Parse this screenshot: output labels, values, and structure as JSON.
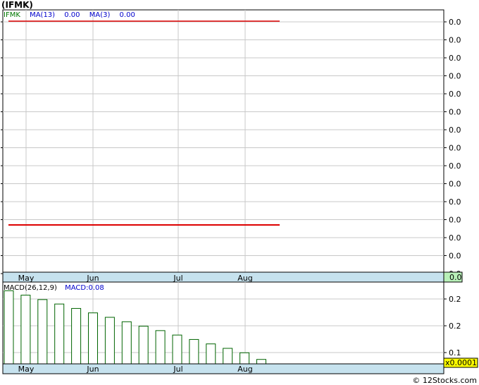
{
  "title": "(IFMK)",
  "credit": "© 12Stocks.com",
  "colors": {
    "grid": "#c8c8c8",
    "frame": "#000000",
    "ma_line": "#dd0000",
    "bar_stroke": "#006400",
    "axis_band": "#c6e2ee",
    "last_price_box": "#b8f0b8",
    "macd_box": "#ffff00",
    "ticker_color": "#007700",
    "ma_text_color": "#0000cc"
  },
  "price_panel": {
    "legend": {
      "ticker": "IFMK",
      "ma13_label": "MA(13)",
      "ma13_value": "0.00",
      "ma3_label": "MA(3)",
      "ma3_value": "0.00"
    },
    "y_tick_labels": [
      "0.0",
      "0.0",
      "0.0",
      "0.0",
      "0.0",
      "0.0",
      "0.0",
      "0.0",
      "0.0",
      "0.0",
      "0.0",
      "0.0",
      "0.0",
      "0.0",
      "0.0"
    ],
    "last_price_label": "0.0",
    "x_labels": [
      "May",
      "Jun",
      "Jul",
      "Aug"
    ]
  },
  "macd_panel": {
    "legend": {
      "label": "MACD(26,12,9)",
      "value_label": "MACD:0.08"
    },
    "y_tick_labels": [
      "0.2",
      "0.2",
      "0.1"
    ],
    "multiplier_label": "x0.0001",
    "x_labels": [
      "May",
      "Jun",
      "Jul",
      "Aug"
    ]
  },
  "chart_data": [
    {
      "type": "line",
      "title": "(IFMK)",
      "series": [
        {
          "name": "MA(13)",
          "values": [
            0.0,
            0.0
          ]
        },
        {
          "name": "MA(3)",
          "values": [
            0.0,
            0.0
          ]
        }
      ],
      "x": [
        "May",
        "Aug"
      ],
      "y_tick_labels": [
        "0.0"
      ],
      "grid": true
    },
    {
      "type": "bar",
      "title": "MACD(26,12,9)",
      "categories": [
        "May",
        "May",
        "May",
        "May",
        "Jun",
        "Jun",
        "Jun",
        "Jun",
        "Jun",
        "Jul",
        "Jul",
        "Jul",
        "Jul",
        "Aug",
        "Aug",
        "Aug"
      ],
      "values": [
        0.26,
        0.25,
        0.24,
        0.23,
        0.22,
        0.21,
        0.2,
        0.19,
        0.18,
        0.17,
        0.16,
        0.15,
        0.14,
        0.13,
        0.12,
        0.105
      ],
      "y_tick_labels": [
        "0.2",
        "0.2",
        "0.1"
      ],
      "ylim": [
        0.095,
        0.27
      ],
      "multiplier": "x0.0001",
      "grid": true
    }
  ]
}
